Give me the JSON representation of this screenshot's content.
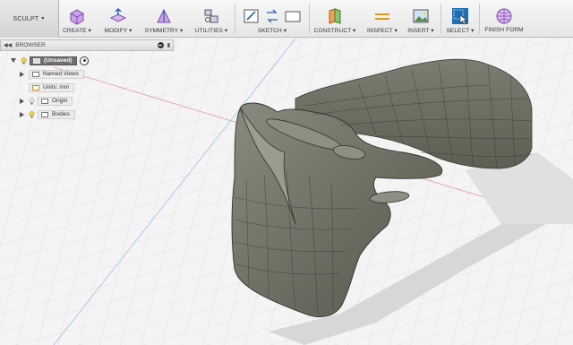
{
  "toolbar": {
    "workspace": "SCULPT",
    "groups": [
      {
        "label": "CREATE"
      },
      {
        "label": "MODIFY"
      },
      {
        "label": "SYMMETRY"
      },
      {
        "label": "UTILITIES"
      },
      {
        "label": "SKETCH"
      },
      {
        "label": "CONSTRUCT"
      },
      {
        "label": "INSPECT"
      },
      {
        "label": "INSERT"
      },
      {
        "label": "SELECT"
      },
      {
        "label": "FINISH FORM"
      }
    ]
  },
  "browser": {
    "title": "BROWSER",
    "root": "(Unsaved)",
    "items": [
      {
        "label": "Named Views"
      },
      {
        "label": "Units: mm"
      },
      {
        "label": "Origin"
      },
      {
        "label": "Bodies"
      }
    ]
  },
  "colors": {
    "accent": "#1f6fb5",
    "model": "#6b6b5f",
    "grid": "#dcdcdc",
    "x_axis": "#e08080",
    "z_axis": "#7aa7e0"
  }
}
